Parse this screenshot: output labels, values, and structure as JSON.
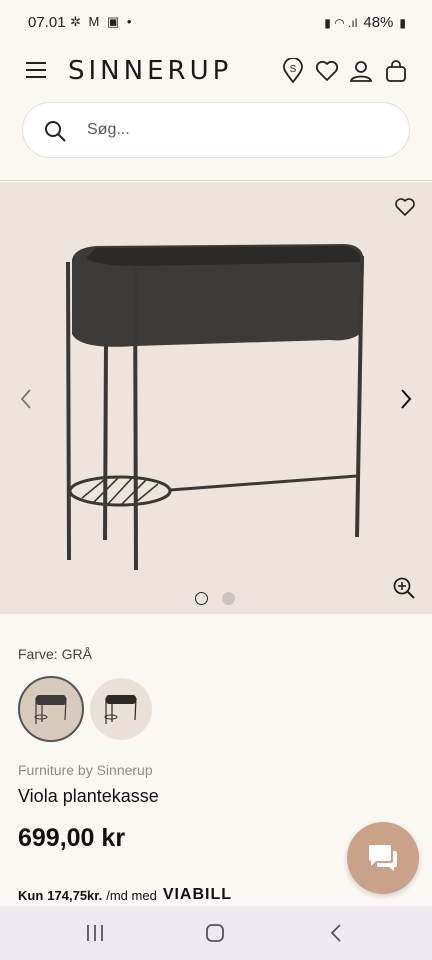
{
  "status_bar": {
    "time": "07.01",
    "left_icons": "✲ M ▣ •",
    "battery": "48%"
  },
  "header": {
    "logo": "SINNERUP"
  },
  "search": {
    "placeholder": "Søg..."
  },
  "gallery": {
    "image_count": 2,
    "active_index": 0
  },
  "product": {
    "color_label": "Farve: GRÅ",
    "brand": "Furniture by Sinnerup",
    "name": "Viola plantekasse",
    "price": "699,00 kr",
    "installment_prefix": "Kun ",
    "installment_amount": "174,75kr.",
    "installment_suffix": " /md med ",
    "installment_provider": "VIABILL"
  },
  "colors": {
    "page_bg": "#fbf8f4",
    "gallery_bg": "#ede5dd",
    "chat_button": "#caa28a",
    "brand_text": "#8f8a86"
  }
}
